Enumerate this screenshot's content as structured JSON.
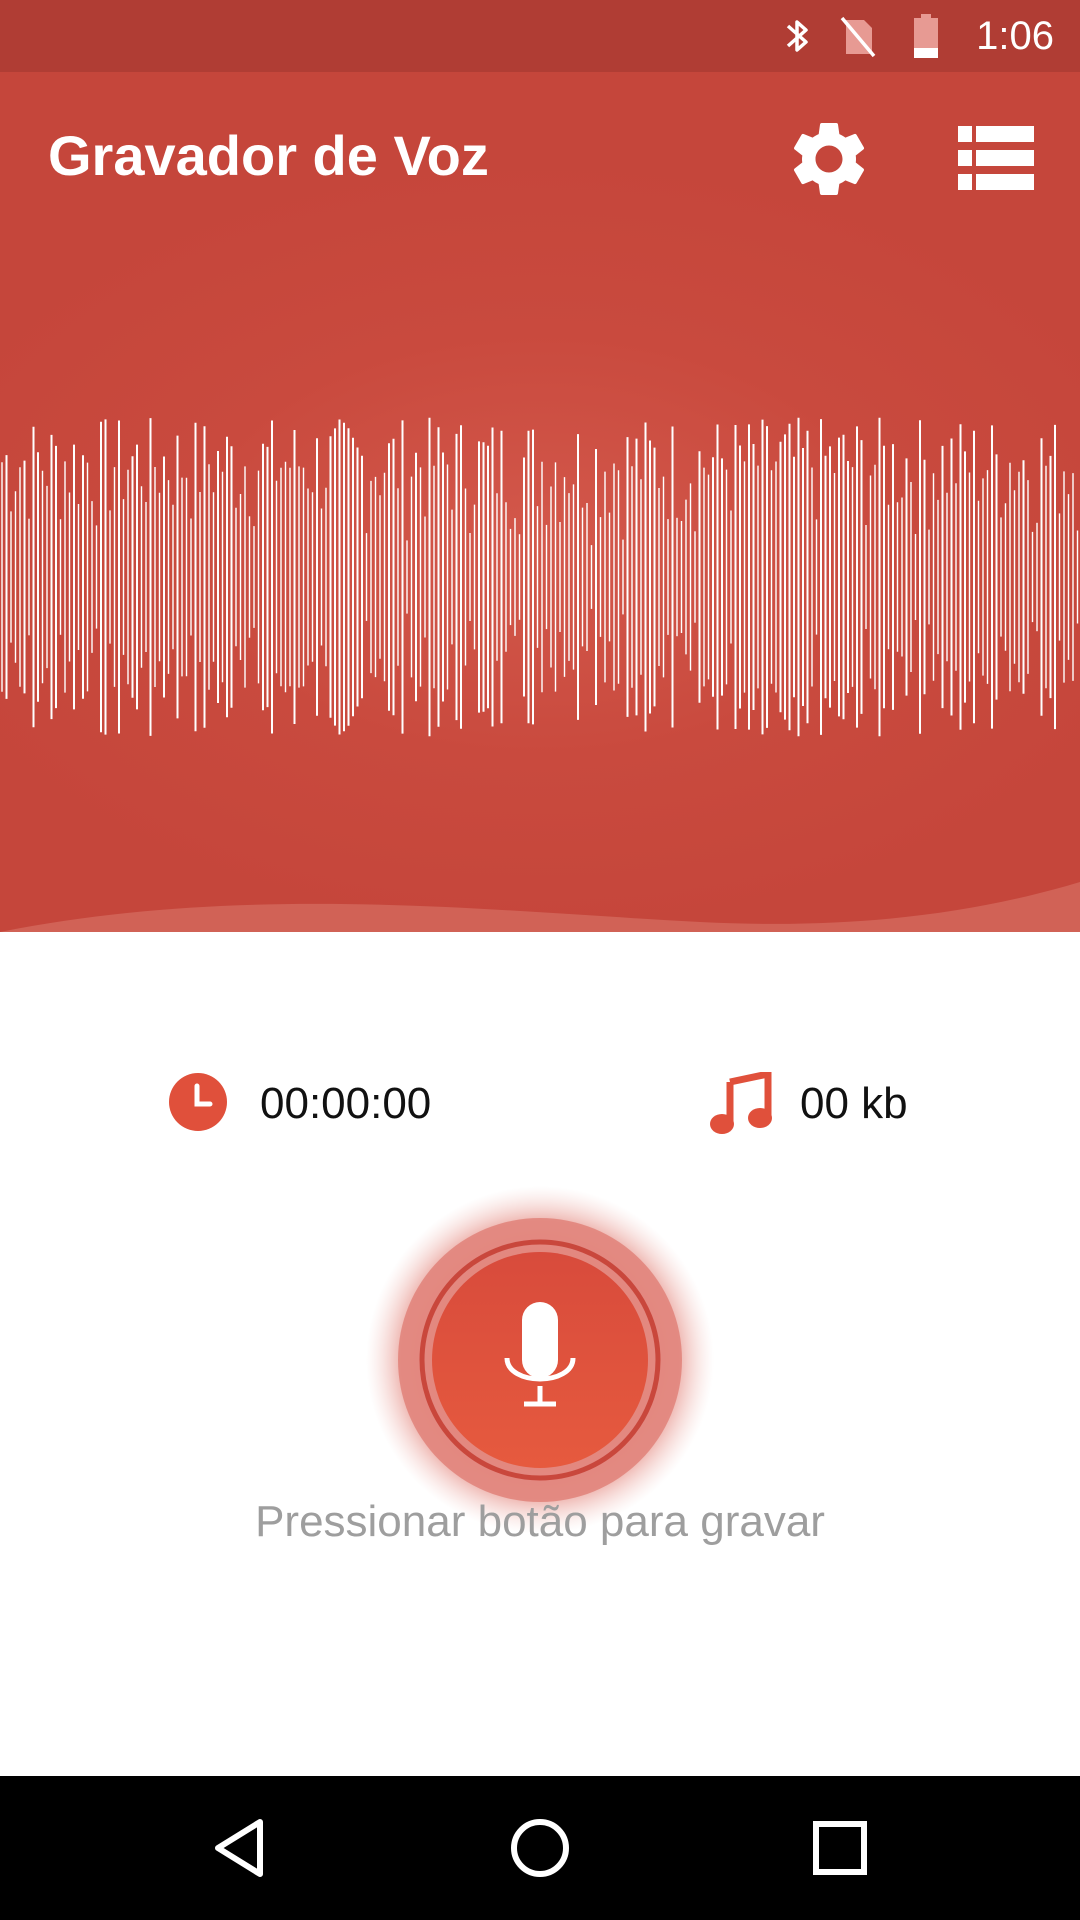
{
  "status_bar": {
    "time": "1:06",
    "icons": [
      "bluetooth-icon",
      "no-sim-icon",
      "battery-icon"
    ]
  },
  "app_bar": {
    "title": "Gravador de Voz",
    "actions": [
      "settings-gear-icon",
      "recordings-list-icon"
    ]
  },
  "stats": {
    "duration": "00:00:00",
    "duration_icon": "clock-icon",
    "file_size": "00 kb",
    "file_size_icon": "music-note-icon"
  },
  "record_button": {
    "icon": "microphone-icon",
    "hint": "Pressionar botão para gravar"
  },
  "nav_bar": {
    "buttons": [
      "back-triangle-icon",
      "home-circle-icon",
      "recents-square-icon"
    ]
  },
  "colors": {
    "primary": "#c5463b",
    "status_bar": "#b03d34",
    "record_button": "#e0503b",
    "hint_text": "#9e9e9e"
  }
}
